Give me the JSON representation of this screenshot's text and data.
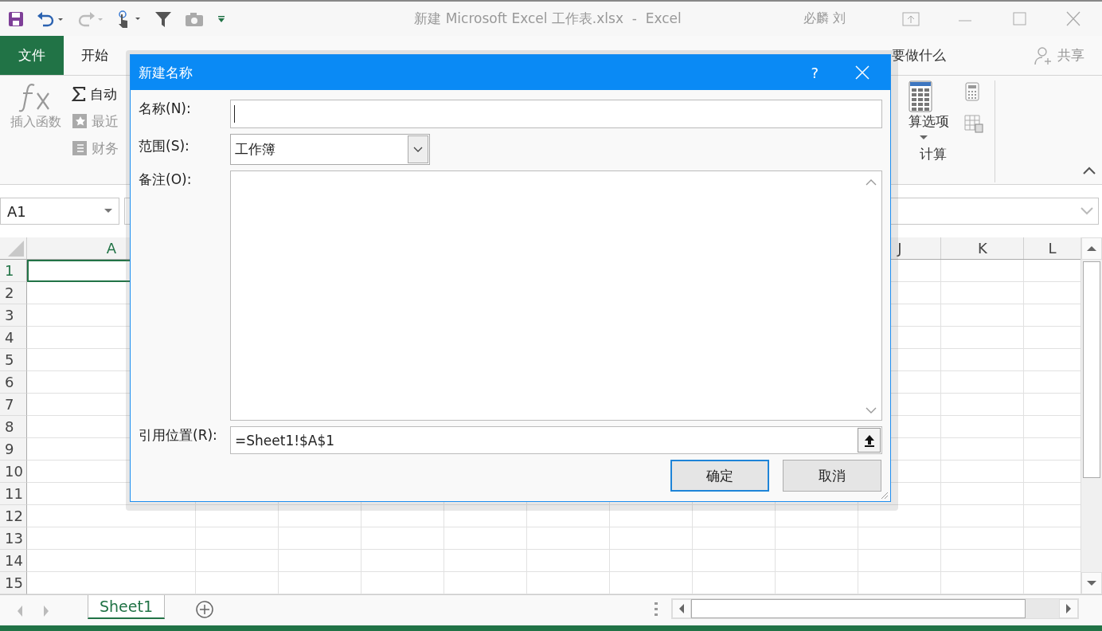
{
  "window": {
    "title": "新建 Microsoft Excel 工作表.xlsx  -  Excel",
    "user": "必麟 刘"
  },
  "ribbon_tabs": [
    {
      "label": "文件",
      "kind": "file",
      "selected": false
    },
    {
      "label": "开始",
      "kind": "tab",
      "selected": false
    }
  ],
  "tell_me": {
    "placeholder": "要做什么"
  },
  "share": "共享",
  "ribbon": {
    "insert_function": "插入函数",
    "autosum": "自动",
    "recent": "最近",
    "financial": "财务",
    "calc_options": "算选项",
    "group_label": "计算"
  },
  "name_box": "A1",
  "columns": [
    {
      "label": "A",
      "kind": "first"
    },
    {
      "label": "J",
      "kind": "right"
    },
    {
      "label": "K",
      "kind": "right"
    },
    {
      "label": "L",
      "kind": "right"
    }
  ],
  "rows": [
    "1",
    "2",
    "3",
    "4",
    "5",
    "6",
    "7",
    "8",
    "9",
    "10",
    "11",
    "12",
    "13",
    "14",
    "15"
  ],
  "sheet_tabs": [
    {
      "label": "Sheet1",
      "selected": true
    }
  ],
  "dialog": {
    "title": "新建名称",
    "help": "?",
    "fields": [
      {
        "kind": "text",
        "label": "名称(N):",
        "focused": true
      },
      {
        "kind": "select",
        "label": "范围(S):",
        "value": "工作簿"
      },
      {
        "kind": "textarea",
        "label": "备注(O):"
      },
      {
        "kind": "reference",
        "label": "引用位置(R):",
        "value": "=Sheet1!$A$1"
      }
    ],
    "buttons": [
      {
        "label": "确定",
        "default": true
      },
      {
        "label": "取消",
        "default": false
      }
    ]
  }
}
